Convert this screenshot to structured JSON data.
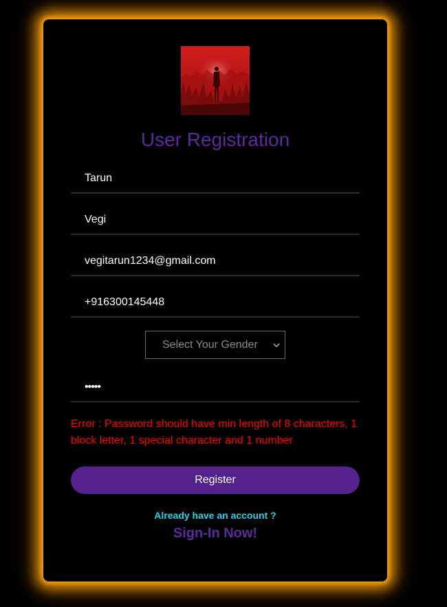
{
  "form": {
    "title": "User Registration",
    "first_name": "Tarun",
    "last_name": "Vegi",
    "email": "vegitarun1234@gmail.com",
    "phone": "+916300145448",
    "gender_selected": "Select Your Gender",
    "password_masked": "•••••",
    "error": "Error : Password should have min length of 8 characters, 1 block letter, 1 special character and 1 number",
    "register_label": "Register",
    "already_label": "Already have an account ?",
    "signin_label": "Sign-In Now!"
  },
  "colors": {
    "glow": "#f59e0b",
    "title": "#5b2a9e",
    "button": "#55218d",
    "error": "#ff0000",
    "link_hint": "#22d3ee"
  }
}
